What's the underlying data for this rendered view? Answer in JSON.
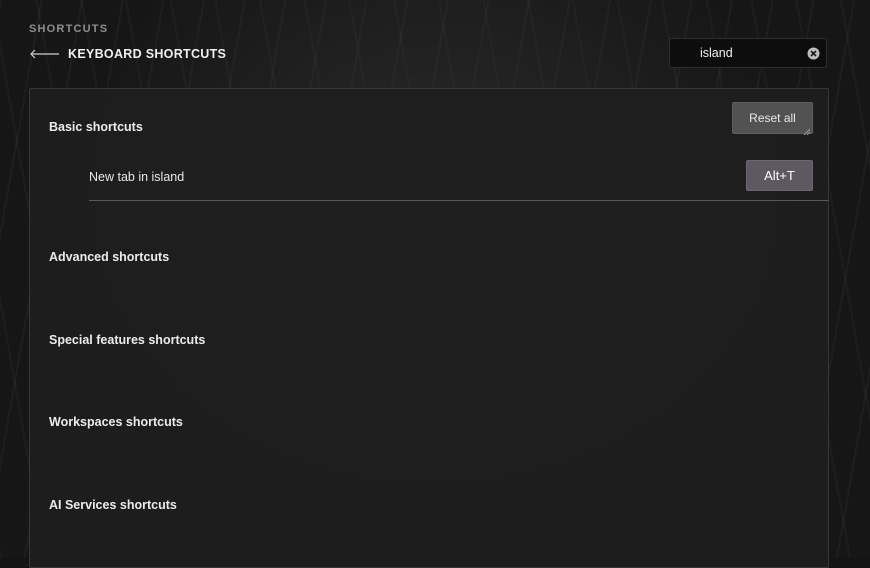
{
  "breadcrumb": "SHORTCUTS",
  "header": {
    "title": "KEYBOARD SHORTCUTS",
    "back_icon": "arrow-left-icon"
  },
  "search": {
    "value": "island",
    "clear_icon": "clear-circle-icon"
  },
  "panel": {
    "reset_label": "Reset all",
    "sections": [
      {
        "title": "Basic shortcuts",
        "items": [
          {
            "label": "New tab in island",
            "shortcut": "Alt+T"
          }
        ]
      },
      {
        "title": "Advanced shortcuts"
      },
      {
        "title": "Special features shortcuts"
      },
      {
        "title": "Workspaces shortcuts"
      },
      {
        "title": "AI Services shortcuts"
      }
    ]
  },
  "colors": {
    "background": "#161616",
    "panel": "#1e1e1e",
    "key_chip": "#5d5862",
    "reset_button": "#525252"
  }
}
